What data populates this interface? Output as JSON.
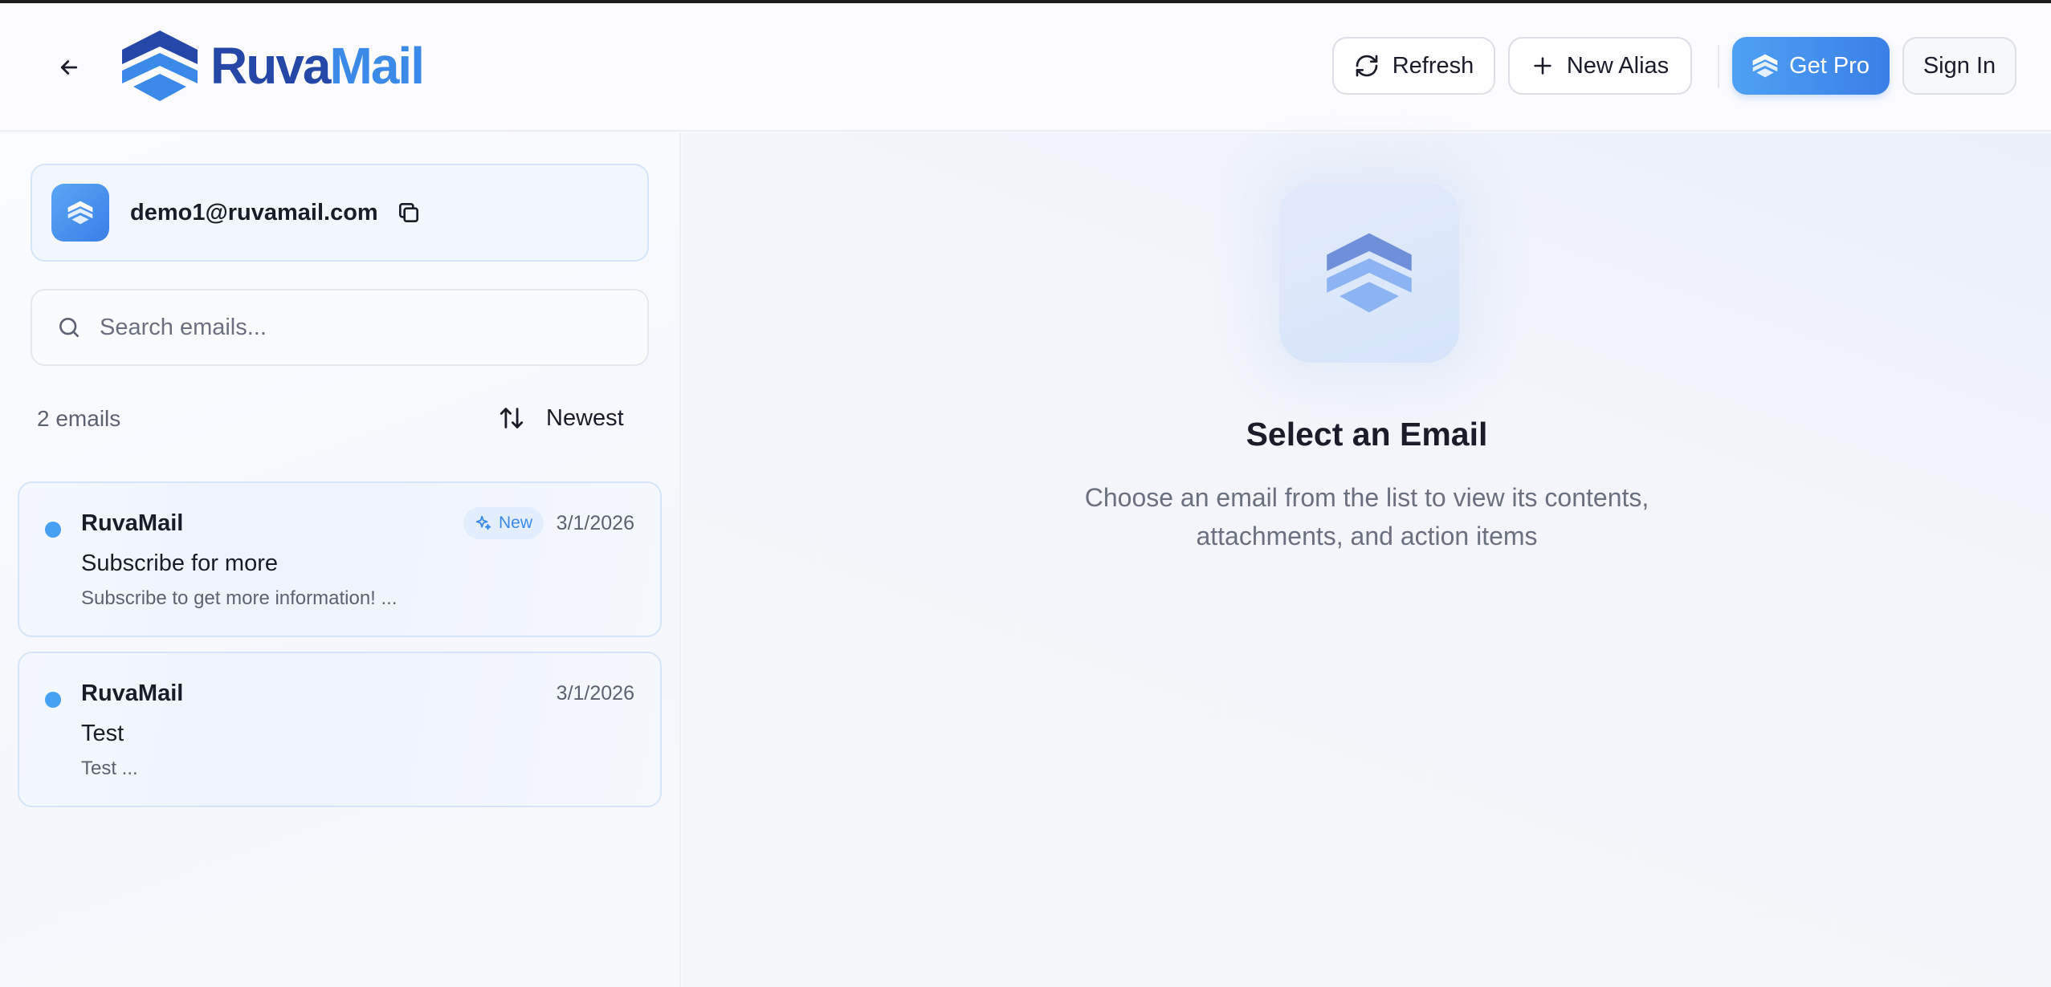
{
  "header": {
    "logo_part1": "Ruva",
    "logo_part2": "Mail",
    "refresh_label": "Refresh",
    "new_alias_label": "New Alias",
    "get_pro_label": "Get Pro",
    "sign_in_label": "Sign In"
  },
  "account": {
    "email": "demo1@ruvamail.com"
  },
  "search": {
    "placeholder": "Search emails...",
    "value": ""
  },
  "list": {
    "count_label": "2 emails",
    "sort_label": "Newest"
  },
  "emails": [
    {
      "sender": "RuvaMail",
      "badge": "New",
      "date": "3/1/2026",
      "subject": "Subscribe for more",
      "preview": "Subscribe to get more information! ..."
    },
    {
      "sender": "RuvaMail",
      "date": "3/1/2026",
      "subject": "Test",
      "preview": "Test ..."
    }
  ],
  "empty_state": {
    "title": "Select an Email",
    "description": "Choose an email from the list to view its contents, attachments, and action items"
  },
  "colors": {
    "brand_dark": "#2547a8",
    "brand_light": "#3b8ae8",
    "accent": "#46a0f4"
  },
  "icons": [
    "arrow-left-icon",
    "refresh-icon",
    "plus-icon",
    "logo-chevrons-icon",
    "copy-icon",
    "search-icon",
    "sort-arrows-icon",
    "sparkle-icon"
  ]
}
